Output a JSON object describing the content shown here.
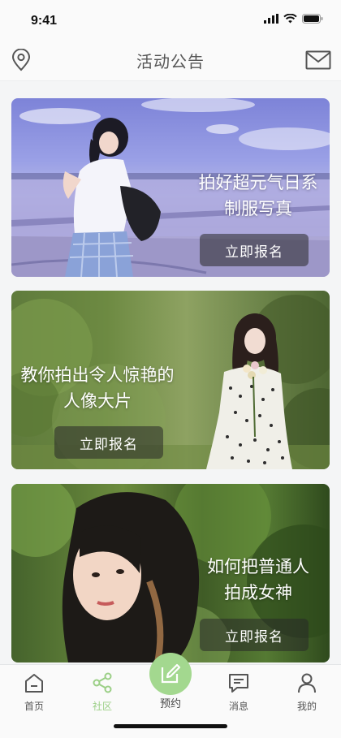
{
  "status": {
    "time": "9:41"
  },
  "header": {
    "title": "活动公告",
    "left_icon": "location-pin-icon",
    "right_icon": "mail-icon"
  },
  "cards": [
    {
      "title_line1": "拍好超元气日系",
      "title_line2": "制服写真",
      "button": "立即报名"
    },
    {
      "title_line1": "教你拍出令人惊艳的",
      "title_line2": "人像大片",
      "button": "立即报名"
    },
    {
      "title_line1": "如何把普通人",
      "title_line2": "拍成女神",
      "button": "立即报名"
    }
  ],
  "tabbar": {
    "items": [
      {
        "label": "首页",
        "icon": "home-icon"
      },
      {
        "label": "社区",
        "icon": "share-icon"
      },
      {
        "label": "预约",
        "icon": "edit-icon"
      },
      {
        "label": "消息",
        "icon": "message-icon"
      },
      {
        "label": "我的",
        "icon": "user-icon"
      }
    ],
    "active_index": 1,
    "accent_color": "#9bcf86"
  }
}
